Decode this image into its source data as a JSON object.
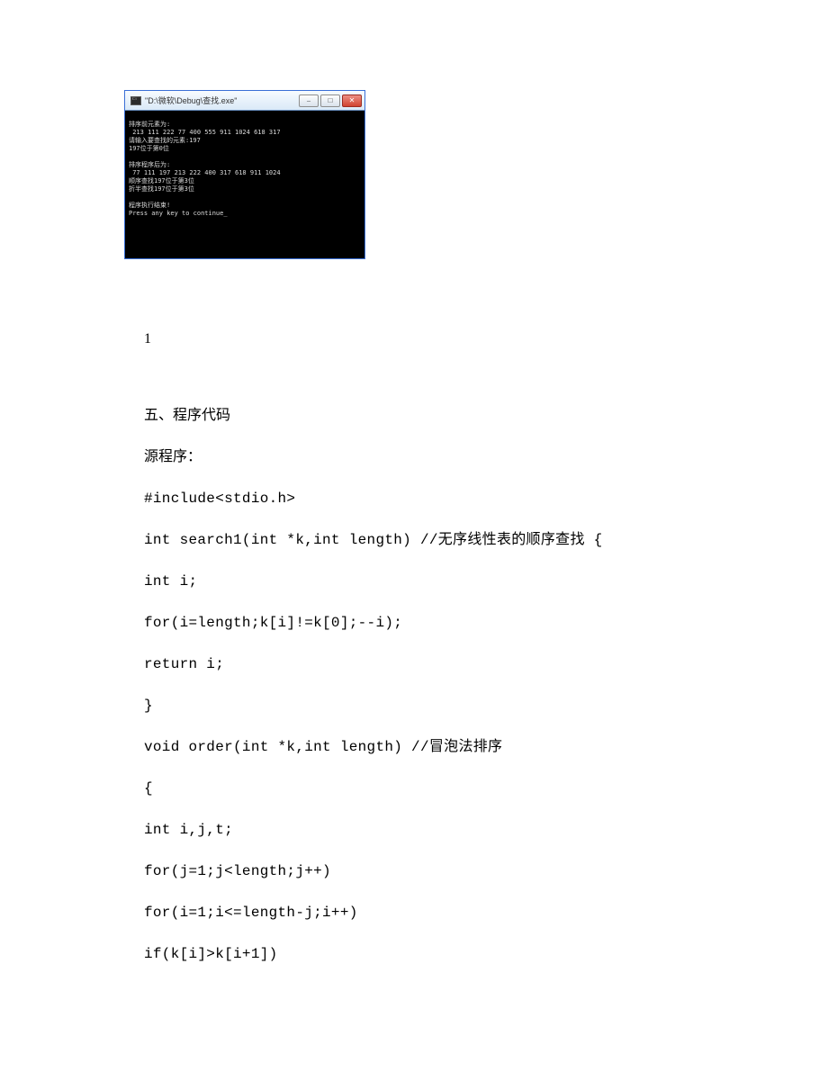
{
  "console": {
    "title": "\"D:\\微软\\Debug\\查找.exe\"",
    "min_glyph": "–",
    "max_glyph": "□",
    "close_glyph": "✕",
    "lines": [
      "排序前元素为:",
      " 213 111 222 77 400 555 911 1024 618 317",
      "请输入要查找的元素:197",
      "197位于第0位",
      "",
      "排序程序后为:",
      " 77 111 197 213 222 400 317 618 911 1024",
      "顺序查找197位于第3位",
      "折半查找197位于第3位",
      "",
      "程序执行结束!",
      "Press any key to continue_"
    ]
  },
  "page_number": "1",
  "section_header": "五、程序代码",
  "sub_header": "源程序：",
  "code": [
    "#include<stdio.h>",
    "int search1(int *k,int length) //无序线性表的顺序查找 {",
    "int i;",
    "for(i=length;k[i]!=k[0];--i);",
    "return i;",
    "}",
    "void order(int *k,int length) //冒泡法排序",
    "{",
    "int i,j,t;",
    "for(j=1;j<length;j++)",
    "for(i=1;i<=length-j;i++)",
    "if(k[i]>k[i+1])"
  ]
}
